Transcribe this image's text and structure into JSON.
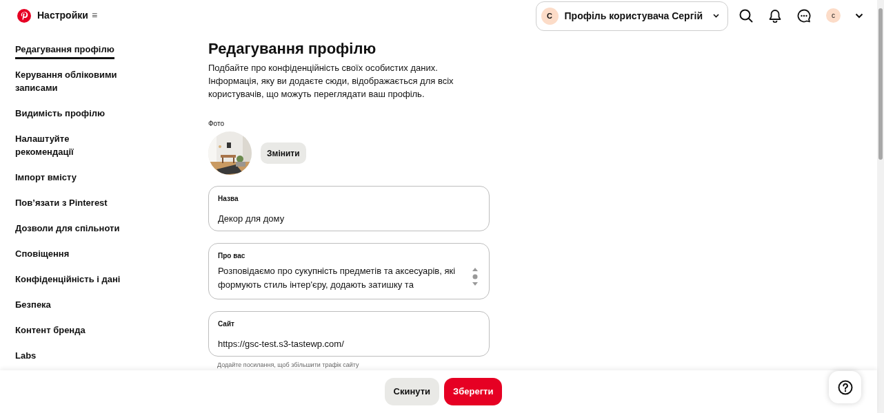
{
  "header": {
    "title": "Настройки",
    "menu_glyph": "≡",
    "profile_switcher": {
      "avatar_letter": "C",
      "label": "Профіль користувача Сергій"
    },
    "avatar_letter": "c"
  },
  "sidebar": {
    "items": [
      {
        "label": "Редагування профілю",
        "selected": true
      },
      {
        "label": "Керування обліковими записами",
        "selected": false
      },
      {
        "label": "Видимість профілю",
        "selected": false
      },
      {
        "label": "Налаштуйте рекомендації",
        "selected": false
      },
      {
        "label": "Імпорт вмісту",
        "selected": false
      },
      {
        "label": "Пов’язати з Pinterest",
        "selected": false
      },
      {
        "label": "Дозволи для спільноти",
        "selected": false
      },
      {
        "label": "Сповіщення",
        "selected": false
      },
      {
        "label": "Конфіденційність і дані",
        "selected": false
      },
      {
        "label": "Безпека",
        "selected": false
      },
      {
        "label": "Контент бренда",
        "selected": false
      },
      {
        "label": "Labs",
        "selected": false
      }
    ]
  },
  "main": {
    "title": "Редагування профілю",
    "description": "Подбайте про конфіденційність своїх особистих даних. Інформація, яку ви додаєте сюди, відображається для всіх користувачів, що можуть переглядати ваш профіль.",
    "photo": {
      "label": "Фото",
      "kind": "picture",
      "button": "Змінити"
    },
    "fields": [
      {
        "kind": "input",
        "label": "Назва",
        "value": "Декор для дому"
      },
      {
        "kind": "textarea",
        "label": "Про вас",
        "value": "Розповідаємо про сукупність предметів та аксесуарів, які формують стиль інтер'єру, додають затишку та"
      },
      {
        "kind": "input",
        "label": "Сайт",
        "value": "https://gsc-test.s3-tastewp.com/",
        "hint": "Додайте посилання, щоб збільшити трафік сайту"
      }
    ]
  },
  "footer": {
    "buttons": [
      {
        "label": "Скинути",
        "kind": "secondary"
      },
      {
        "label": "Зберегти",
        "kind": "primary"
      }
    ]
  }
}
